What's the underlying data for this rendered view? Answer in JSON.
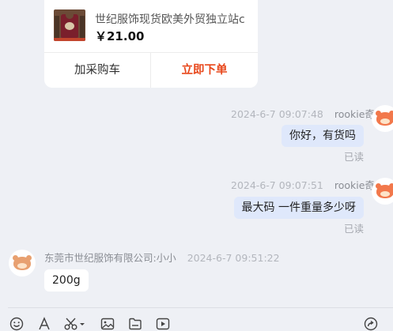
{
  "product": {
    "title": "世纪服饰现货欧美外贸独立站c",
    "price": "￥21.00",
    "add_to_cart_label": "加采购车",
    "buy_now_label": "立即下单"
  },
  "messages": [
    {
      "side": "right",
      "time": "2024-6-7 09:07:48",
      "sender": "rookie奇",
      "text": "你好，有货吗",
      "status": "已读"
    },
    {
      "side": "right",
      "time": "2024-6-7 09:07:51",
      "sender": "rookie奇",
      "text": "最大码 一件重量多少呀",
      "status": "已读"
    },
    {
      "side": "left",
      "sender": "东莞市世纪服饰有限公司:小小",
      "time": "2024-6-7 09:51:22",
      "text": "200g"
    }
  ],
  "toolbar": {
    "icons": [
      "emoji-icon",
      "font-icon",
      "scissors-icon",
      "image-icon",
      "file-icon",
      "video-icon",
      "share-icon"
    ]
  },
  "colors": {
    "accent": "#e8481c",
    "my_bubble": "#dfe8fb",
    "background": "#eef0f5"
  }
}
